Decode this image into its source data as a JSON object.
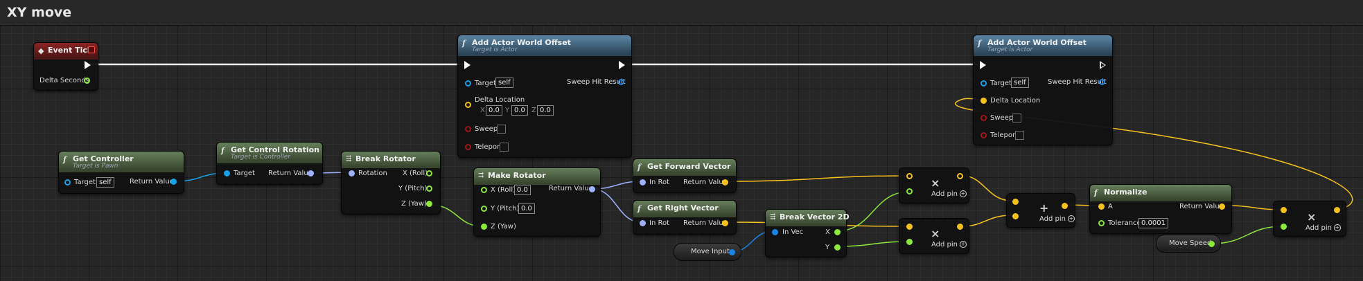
{
  "graph": {
    "title": "XY move"
  },
  "colors": {
    "exec": "#ffffff",
    "object": "#14a1e8",
    "vector": "#f7c21c",
    "rotator": "#9db1ff",
    "float": "#8ce83d",
    "bool": "#a11616",
    "struct": "#1b84e6"
  },
  "nodes": {
    "event_tick": {
      "title": "Event Tick",
      "delta": "Delta Seconds"
    },
    "get_controller": {
      "title": "Get Controller",
      "subtitle": "Target is Pawn",
      "target": "Target",
      "target_value": "self",
      "return": "Return Value"
    },
    "get_control_rotation": {
      "title": "Get Control Rotation",
      "subtitle": "Target is Controller",
      "target": "Target",
      "return": "Return Value"
    },
    "break_rotator": {
      "title": "Break Rotator",
      "rotation": "Rotation",
      "x": "X (Roll)",
      "y": "Y (Pitch)",
      "z": "Z (Yaw)"
    },
    "make_rotator": {
      "title": "Make Rotator",
      "x": "X (Roll)",
      "x_value": "0.0",
      "y": "Y (Pitch)",
      "y_value": "0.0",
      "z": "Z (Yaw)",
      "return": "Return Value"
    },
    "add_offset_1": {
      "title": "Add Actor World Offset",
      "subtitle": "Target is Actor",
      "target": "Target",
      "target_value": "self",
      "sweep_hit": "Sweep Hit Result",
      "delta": "Delta Location",
      "ax": "X",
      "vx": "0.0",
      "ay": "Y",
      "vy": "0.0",
      "az": "Z",
      "vz": "0.0",
      "sweep": "Sweep",
      "teleport": "Teleport"
    },
    "add_offset_2": {
      "title": "Add Actor World Offset",
      "subtitle": "Target is Actor",
      "target": "Target",
      "target_value": "self",
      "sweep_hit": "Sweep Hit Result",
      "delta": "Delta Location",
      "sweep": "Sweep",
      "teleport": "Teleport"
    },
    "get_forward": {
      "title": "Get Forward Vector",
      "in": "In Rot",
      "return": "Return Value"
    },
    "get_right": {
      "title": "Get Right Vector",
      "in": "In Rot",
      "return": "Return Value"
    },
    "move_input": {
      "label": "Move Input"
    },
    "break_vec2d": {
      "title": "Break Vector 2D",
      "in": "In Vec",
      "x": "X",
      "y": "Y"
    },
    "mul_1": {
      "symbol": "×",
      "addpin": "Add pin"
    },
    "mul_2": {
      "symbol": "×",
      "addpin": "Add pin"
    },
    "add_1": {
      "symbol": "+",
      "addpin": "Add pin"
    },
    "normalize": {
      "title": "Normalize",
      "a": "A",
      "return": "Return Value",
      "tolerance": "Tolerance",
      "tol_value": "0.0001"
    },
    "move_speed": {
      "label": "Move Speed"
    },
    "mul_3": {
      "symbol": "×",
      "addpin": "Add pin"
    }
  }
}
